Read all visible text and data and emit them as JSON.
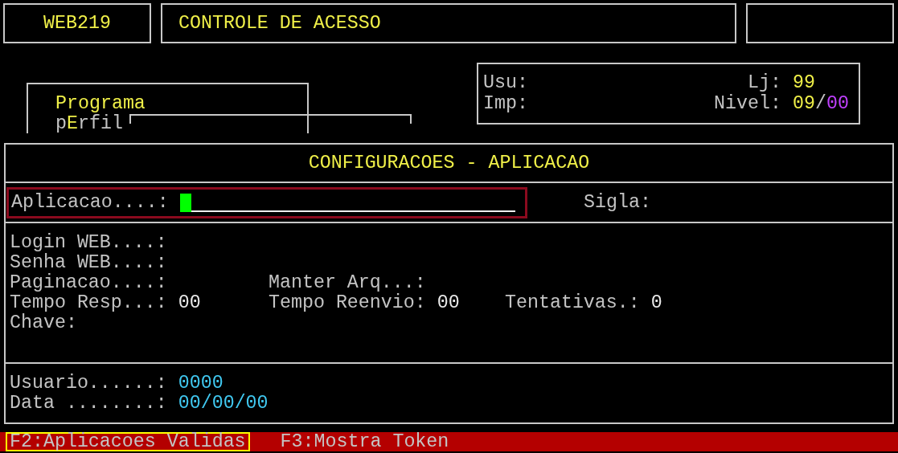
{
  "header": {
    "program_code": "WEB219",
    "title": "CONTROLE DE ACESSO"
  },
  "tabs": [
    {
      "selected": true,
      "parts": [
        {
          "text": "Programa"
        }
      ]
    },
    {
      "selected": false,
      "parts": [
        {
          "text": "p",
          "hotkey": false
        },
        {
          "text": "E",
          "hotkey": true
        },
        {
          "text": "rfil",
          "hotkey": false
        }
      ]
    }
  ],
  "session": {
    "usu_label": "Usu:",
    "imp_label": "Imp:",
    "lj_label": "Lj:",
    "lj_value": "99",
    "nivel_label": "Nivel:",
    "nivel_value": "09",
    "nivel_separator": "/",
    "nivel_sub_value": "00"
  },
  "panel": {
    "title": "CONFIGURACOES - APLICACAO",
    "application_field": {
      "label": "Aplicacao....:",
      "focused": true
    },
    "sigla_label": "Sigla:",
    "field_rows": [
      [
        {
          "label": "Login WEB....:"
        }
      ],
      [
        {
          "label": "Senha WEB....:"
        }
      ],
      [
        {
          "label": "Paginacao....:"
        },
        {
          "label": "Manter Arq...:"
        }
      ],
      [
        {
          "label": "Tempo Resp...:",
          "value": "00"
        },
        {
          "label": "Tempo Reenvio:",
          "value": "00"
        },
        {
          "label": "Tentativas.:",
          "value": "0"
        }
      ],
      [
        {
          "label": "Chave:"
        }
      ]
    ],
    "audit": [
      {
        "label": "Usuario......:",
        "value": "0000"
      },
      {
        "label": "Data ........:",
        "value": "00/00/00"
      }
    ]
  },
  "function_keys": [
    {
      "label": "F2:Aplicacoes Validas",
      "selected": true
    },
    {
      "label": "F3:Mostra Token",
      "selected": false
    }
  ]
}
